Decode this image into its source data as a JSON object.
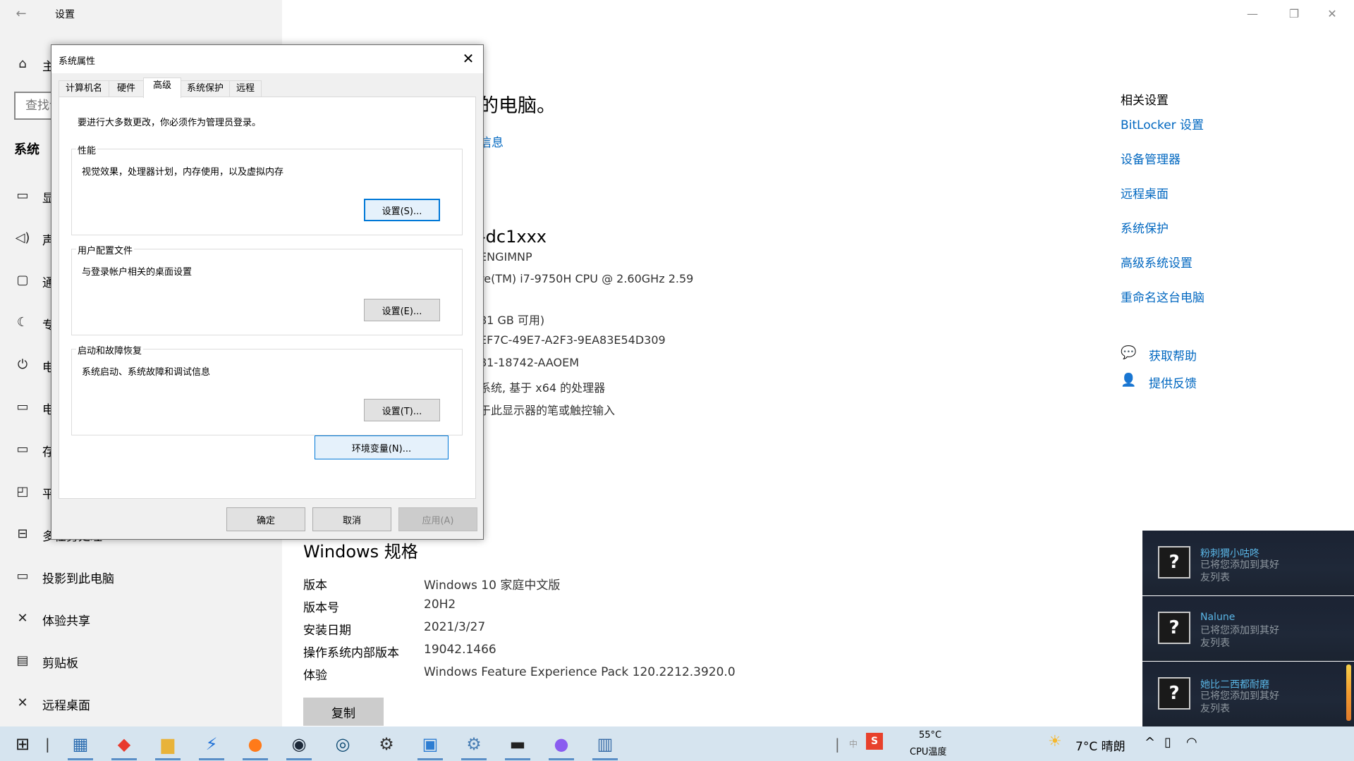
{
  "settings": {
    "title": "设置",
    "back_icon": "←",
    "win_controls": {
      "minimize": "—",
      "maximize": "❐",
      "close": "✕"
    },
    "home_label": "主页",
    "search_placeholder": "查找设置",
    "section": "系统",
    "nav": [
      {
        "icon": "▭",
        "label": "显示"
      },
      {
        "icon": "◁)",
        "label": "声音"
      },
      {
        "icon": "▢",
        "label": "通知和操作"
      },
      {
        "icon": "☾",
        "label": "专注助手"
      },
      {
        "icon": "⏻",
        "label": "电源和睡眠"
      },
      {
        "icon": "▭",
        "label": "电池"
      },
      {
        "icon": "▭",
        "label": "存储"
      },
      {
        "icon": "◰",
        "label": "平板模式"
      },
      {
        "icon": "⊟",
        "label": "多任务处理"
      },
      {
        "icon": "▭",
        "label": "投影到此电脑"
      },
      {
        "icon": "✕",
        "label": "体验共享"
      },
      {
        "icon": "▤",
        "label": "剪贴板"
      },
      {
        "icon": "✕",
        "label": "远程桌面"
      }
    ],
    "main": {
      "heading_fragment": "的电脑。",
      "link_fragment": "信息",
      "device_name_fragment": "-dc1xxx",
      "specs": [
        "ENGIMNP",
        "re(TM) i7-9750H CPU @ 2.60GHz   2.59",
        "81 GB 可用)",
        "EF7C-49E7-A2F3-9EA83E54D309",
        "81-18742-AAOEM",
        "系统, 基于 x64 的处理器",
        "于此显示器的笔或触控输入"
      ],
      "windows_spec_title": "Windows 规格",
      "windows_spec": [
        {
          "key": "版本",
          "value": "Windows 10 家庭中文版"
        },
        {
          "key": "版本号",
          "value": "20H2"
        },
        {
          "key": "安装日期",
          "value": "2021/3/27"
        },
        {
          "key": "操作系统内部版本",
          "value": "19042.1466"
        },
        {
          "key": "体验",
          "value": "Windows Feature Experience Pack 120.2212.3920.0"
        }
      ],
      "copy_label": "复制"
    },
    "related": {
      "title": "相关设置",
      "links": [
        "BitLocker 设置",
        "设备管理器",
        "远程桌面",
        "系统保护",
        "高级系统设置",
        "重命名这台电脑"
      ],
      "help": {
        "icon": "💬",
        "label": "获取帮助"
      },
      "feedback": {
        "icon": "👤",
        "label": "提供反馈"
      }
    }
  },
  "dialog": {
    "title": "系统属性",
    "close_icon": "✕",
    "tabs": [
      "计算机名",
      "硬件",
      "高级",
      "系统保护",
      "远程"
    ],
    "active_tab": "高级",
    "admin_note": "要进行大多数更改，你必须作为管理员登录。",
    "groups": [
      {
        "title": "性能",
        "desc": "视觉效果，处理器计划，内存使用，以及虚拟内存",
        "button": "设置(S)..."
      },
      {
        "title": "用户配置文件",
        "desc": "与登录帐户相关的桌面设置",
        "button": "设置(E)..."
      },
      {
        "title": "启动和故障恢复",
        "desc": "系统启动、系统故障和调试信息",
        "button": "设置(T)..."
      }
    ],
    "env_button": "环境变量(N)...",
    "ok": "确定",
    "cancel": "取消",
    "apply": "应用(A)"
  },
  "notifications": [
    {
      "name": "粉刺猬小咕咚",
      "message": "已将您添加到其好友列表",
      "avatar_icon": "?"
    },
    {
      "name": "Nalune",
      "message": "已将您添加到其好友列表",
      "avatar_icon": "?"
    },
    {
      "name": "她比二西都耐磨",
      "message": "已将您添加到其好友列表",
      "avatar_icon": "?"
    }
  ],
  "taskbar": {
    "apps": [
      {
        "name": "start-icon",
        "glyph": "⊞",
        "color": "#1a1a1a"
      },
      {
        "name": "store-icon",
        "glyph": "▦",
        "color": "#2b6cb0"
      },
      {
        "name": "app-red-diamond-icon",
        "glyph": "◆",
        "color": "#e83a2e"
      },
      {
        "name": "file-explorer-icon",
        "glyph": "▆",
        "color": "#e8b33a"
      },
      {
        "name": "app-blue-icon",
        "glyph": "⚡",
        "color": "#1d6fd6"
      },
      {
        "name": "firefox-icon",
        "glyph": "●",
        "color": "#ff7a1a"
      },
      {
        "name": "steam-icon",
        "glyph": "◉",
        "color": "#1b2838"
      },
      {
        "name": "app-ring-icon",
        "glyph": "◎",
        "color": "#0f4b73"
      },
      {
        "name": "settings-gear-icon",
        "glyph": "⚙",
        "color": "#333333"
      },
      {
        "name": "system-info-icon",
        "glyph": "▣",
        "color": "#2d7dd2"
      },
      {
        "name": "control-panel-icon",
        "glyph": "⚙",
        "color": "#4a7fb5"
      },
      {
        "name": "terminal-icon",
        "glyph": "▬",
        "color": "#222222"
      },
      {
        "name": "app-flame-icon",
        "glyph": "●",
        "color": "#8a5cf0"
      },
      {
        "name": "system-properties-icon",
        "glyph": "▥",
        "color": "#3a6ea8"
      }
    ],
    "ime_label": "中",
    "cpu_temp": "55°C",
    "cpu_label": "CPU温度",
    "weather_icon": "☀",
    "weather": "7°C  晴朗",
    "tray_up_icon": "^",
    "battery_icon": "▯",
    "wifi_icon": "◠"
  }
}
